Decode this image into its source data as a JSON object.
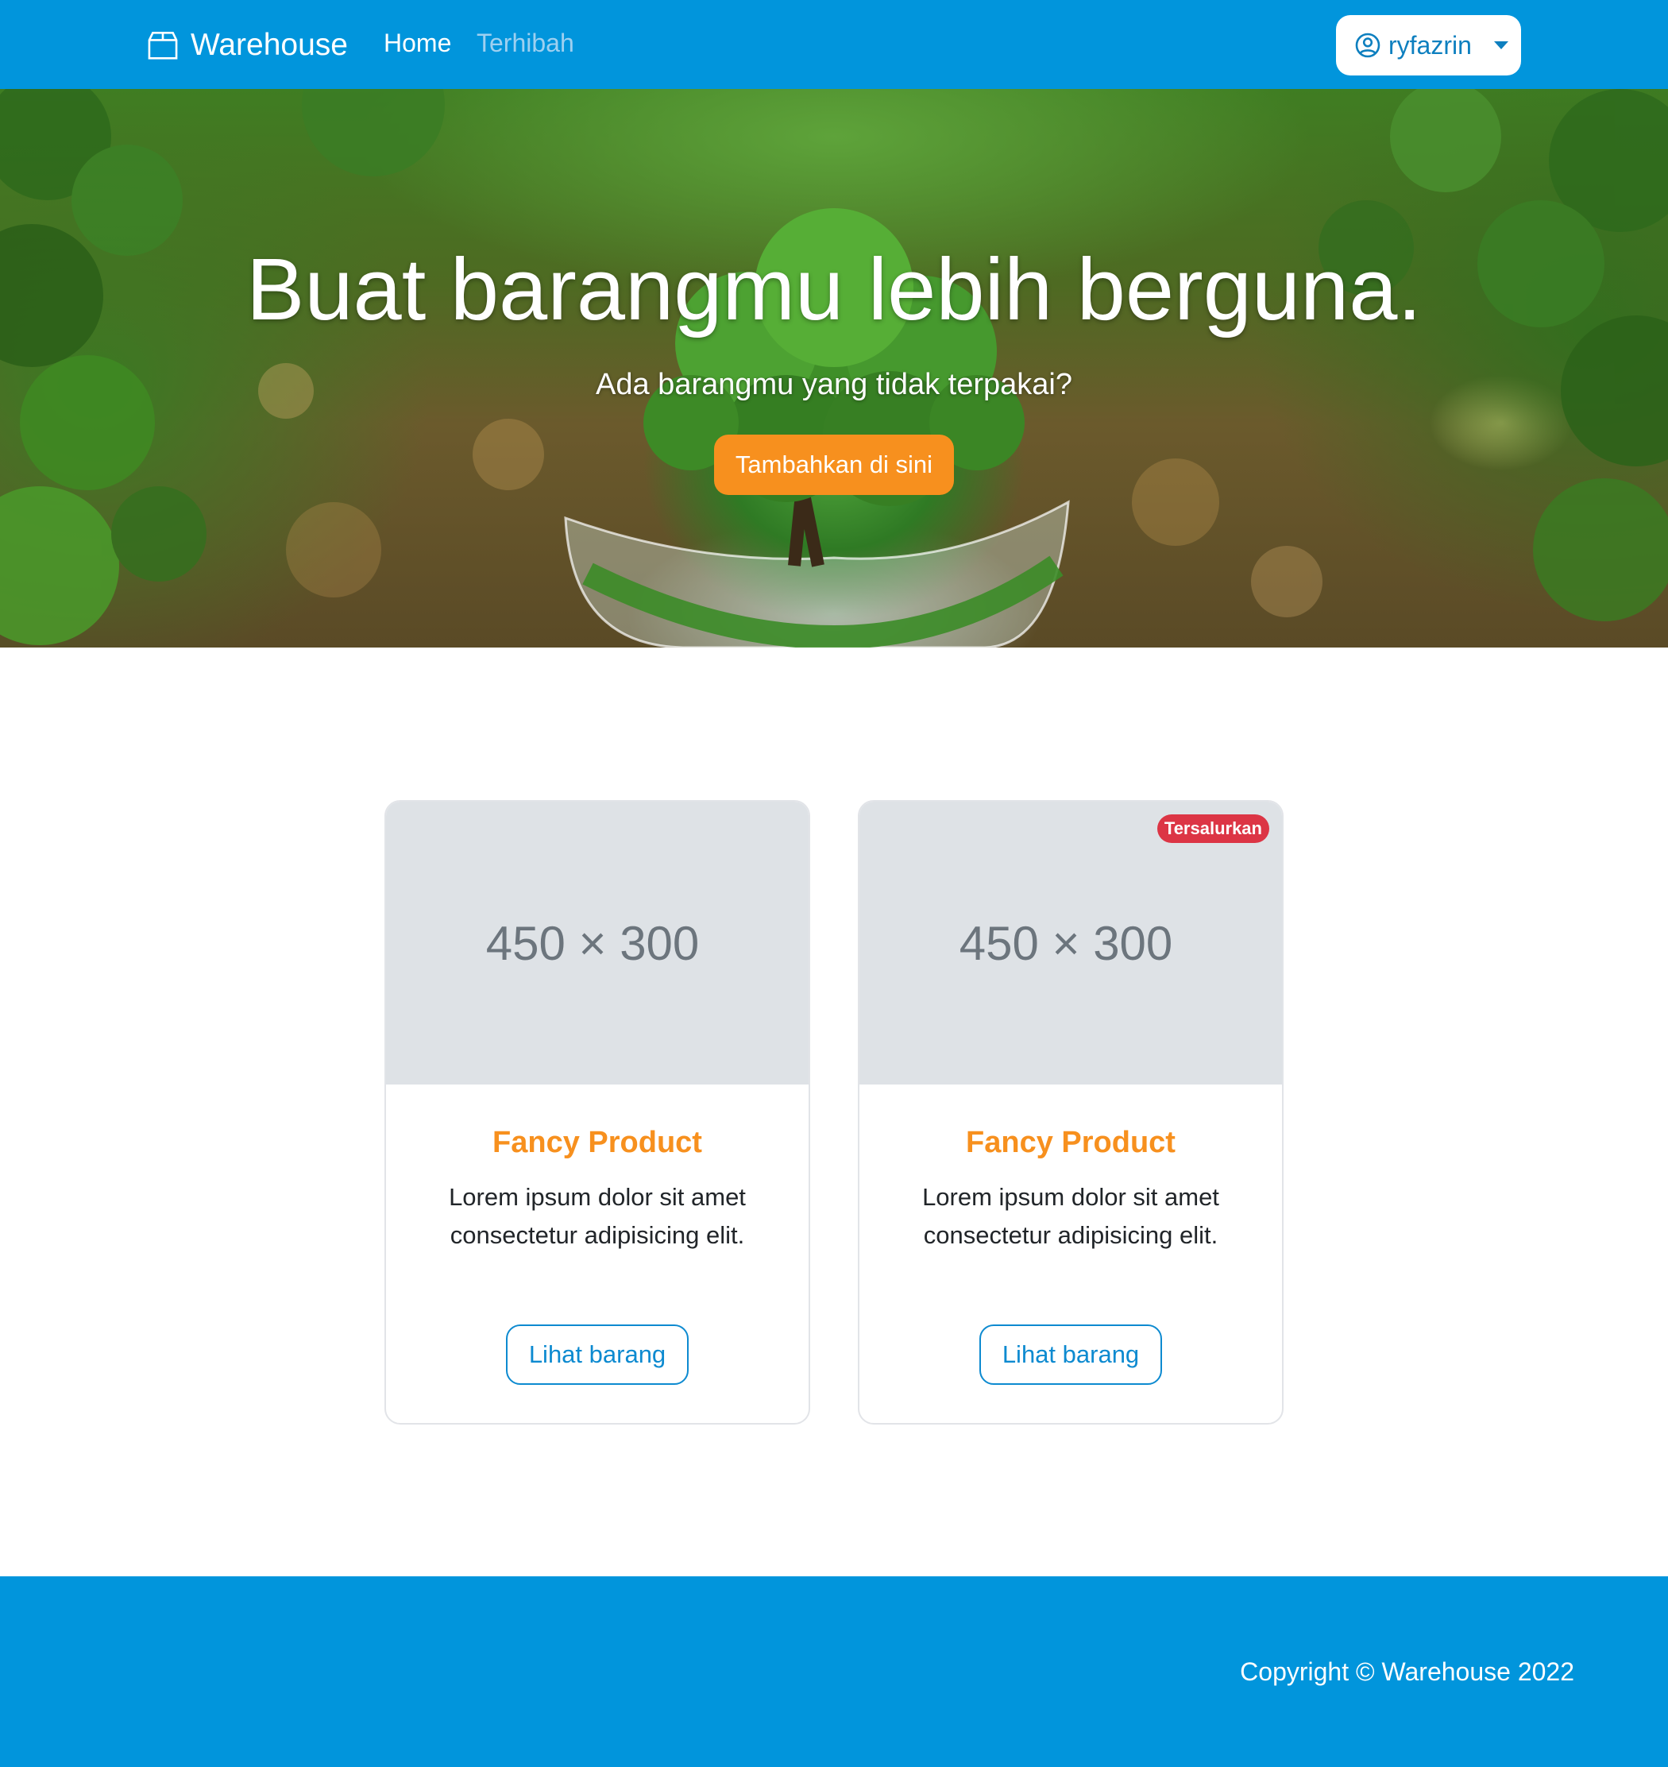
{
  "navbar": {
    "brand": "Warehouse",
    "brand_icon": "box-icon",
    "links": [
      {
        "label": "Home",
        "active": true
      },
      {
        "label": "Terhibah",
        "active": false
      }
    ],
    "user": {
      "name": "ryfazrin",
      "icon": "user-circle-icon"
    },
    "color": "#0195dc"
  },
  "hero": {
    "title": "Buat barangmu lebih berguna.",
    "subtitle": "Ada barangmu yang tidak terpakai?",
    "button": "Tambahkan di sini",
    "button_color": "#f7901e"
  },
  "products": [
    {
      "image_placeholder": "450 × 300",
      "title": "Fancy Product",
      "description": "Lorem ipsum dolor sit amet consectetur adipisicing elit.",
      "button": "Lihat barang"
    },
    {
      "badge": "Tersalurkan",
      "badge_color": "#dc3545",
      "image_placeholder": "450 × 300",
      "title": "Fancy Product",
      "description": "Lorem ipsum dolor sit amet consectetur adipisicing elit.",
      "button": "Lihat barang"
    }
  ],
  "footer": {
    "copyright": "Copyright © Warehouse 2022"
  }
}
